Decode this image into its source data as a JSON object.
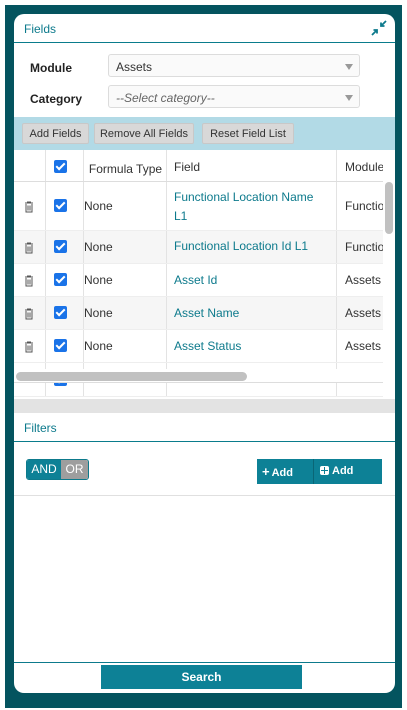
{
  "fields_section": {
    "title": "Fields",
    "collapse_icon": "collapse-arrows-icon"
  },
  "form": {
    "module_label": "Module",
    "module_value": "Assets",
    "category_label": "Category",
    "category_placeholder": "--Select category--"
  },
  "toolbar": {
    "add_fields": "Add Fields",
    "remove_all_fields": "Remove All Fields",
    "reset_field_list": "Reset Field List"
  },
  "grid": {
    "columns": [
      "Formula Type",
      "Field",
      "Module"
    ],
    "rows": [
      {
        "formula_type": "None",
        "field_line1": "Functional Location Name",
        "field_line2": "L1",
        "module": "Functio"
      },
      {
        "formula_type": "None",
        "field_line1": "Functional Location Id L1",
        "field_line2": "",
        "module": "Functio"
      },
      {
        "formula_type": "None",
        "field_line1": "Asset Id",
        "field_line2": "",
        "module": "Assets"
      },
      {
        "formula_type": "None",
        "field_line1": "Asset Name",
        "field_line2": "",
        "module": "Assets"
      },
      {
        "formula_type": "None",
        "field_line1": "Asset Status",
        "field_line2": "",
        "module": "Assets"
      }
    ]
  },
  "filters_section": {
    "title": "Filters",
    "and_label": "AND",
    "or_label": "OR",
    "add_rule": "Add rule",
    "add_group": "Add group"
  },
  "search": {
    "label": "Search"
  },
  "colors": {
    "accent": "#0d8196",
    "frame": "#04545f",
    "toolbar_bg": "#b2dae6"
  }
}
